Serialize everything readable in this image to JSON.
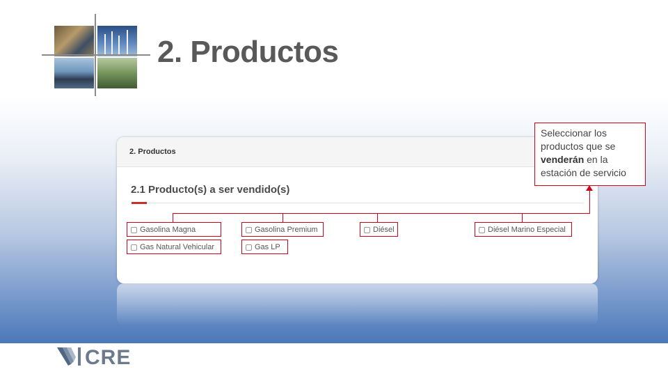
{
  "slide": {
    "title": "2. Productos",
    "brand": "CRE"
  },
  "panel": {
    "header": "2. Productos",
    "section_title": "2.1 Producto(s) a ser vendido(s)",
    "options": [
      {
        "label": "Gasolina Magna",
        "checked": false
      },
      {
        "label": "Gasolina Premium",
        "checked": false
      },
      {
        "label": "Diésel",
        "checked": false
      },
      {
        "label": "Diésel Marino Especial",
        "checked": false
      },
      {
        "label": "Gas Natural Vehicular",
        "checked": false
      },
      {
        "label": "Gas LP",
        "checked": false
      }
    ]
  },
  "callout": {
    "line1": "Seleccionar los productos que se",
    "bold": "venderán",
    "line2": " en la estación de servicio"
  },
  "colors": {
    "highlight": "#d0021b",
    "title": "#595959",
    "gradient_bottom": "#4a78b9"
  }
}
